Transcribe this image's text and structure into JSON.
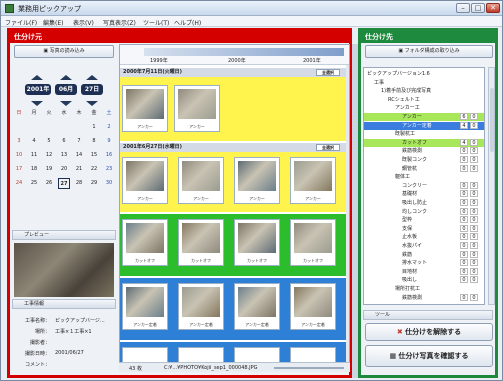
{
  "window": {
    "title": "業務用ピックアップ"
  },
  "menu": [
    "ファイル(F)",
    "編集(E)",
    "表示(V)",
    "写真表示(Z)",
    "ツール(T)",
    "ヘルプ(H)"
  ],
  "left": {
    "header": "仕分け元",
    "load_button": "写真の読み込み",
    "year": "2001年",
    "month": "06月",
    "day": "27日",
    "weekdays": [
      "日",
      "月",
      "火",
      "水",
      "木",
      "金",
      "土"
    ],
    "cal_rows": [
      [
        "",
        "",
        "",
        "",
        "",
        "1",
        "2"
      ],
      [
        "3",
        "4",
        "5",
        "6",
        "7",
        "8",
        "9"
      ],
      [
        "10",
        "11",
        "12",
        "13",
        "14",
        "15",
        "16"
      ],
      [
        "17",
        "18",
        "19",
        "20",
        "21",
        "22",
        "23"
      ],
      [
        "24",
        "25",
        "26",
        "27",
        "28",
        "29",
        "30"
      ]
    ],
    "preview_label": "プレビュー",
    "info_label": "工事情報",
    "info": [
      {
        "k": "工事名称：",
        "v": "ピックアップバージ..."
      },
      {
        "k": "場所：",
        "v": "工事×１工事×1"
      },
      {
        "k": "撮影者：",
        "v": ""
      },
      {
        "k": "撮影日時：",
        "v": "2001/06/27"
      },
      {
        "k": "コメント：",
        "v": ""
      }
    ]
  },
  "timeline": {
    "years": [
      "1999年",
      "2000年",
      "2001年"
    ]
  },
  "groups": [
    {
      "date": "2000年7月11日(火曜日)",
      "select_all": "全選択",
      "captions": [
        "アンカー",
        "アンカー"
      ]
    },
    {
      "date": "2001年6月27日(水曜日)",
      "select_all": "全選択",
      "rows": [
        [
          "アンカー",
          "アンカー",
          "アンカー",
          "アンカー"
        ],
        [
          "カットオフ",
          "カットオフ",
          "カットオフ",
          "カットオフ"
        ],
        [
          "アンカー定着",
          "アンカー定着",
          "アンカー定着",
          "アンカー定着"
        ]
      ]
    }
  ],
  "status": {
    "count": "43 枚",
    "path": "C:¥...¥PHOTO¥Kojii_sep1_000048.JPG"
  },
  "right": {
    "header": "仕分け先",
    "folder_button": "フォルダ構成の取り込み",
    "tree": [
      {
        "label": "ピックアップバージョン1.6",
        "level": 0,
        "a": "",
        "b": ""
      },
      {
        "label": "工事",
        "level": 1,
        "a": "",
        "b": ""
      },
      {
        "label": "1)着手前及び完成写真",
        "level": 2,
        "a": "",
        "b": ""
      },
      {
        "label": "RCシェルト工",
        "level": 3,
        "a": "",
        "b": ""
      },
      {
        "label": "アンカー工",
        "level": 4,
        "a": "",
        "b": ""
      },
      {
        "label": "アンカー",
        "level": 5,
        "a": "6",
        "b": "0"
      },
      {
        "label": "アンカー定着",
        "level": 5,
        "a": "4",
        "b": "0"
      },
      {
        "label": "既製杭工",
        "level": 4,
        "a": "",
        "b": ""
      },
      {
        "label": "カットオフ",
        "level": 5,
        "a": "4",
        "b": "0"
      },
      {
        "label": "鉄筋検測",
        "level": 5,
        "a": "0",
        "b": "0"
      },
      {
        "label": "既製コンク",
        "level": 5,
        "a": "0",
        "b": "0"
      },
      {
        "label": "鋼管杭",
        "level": 5,
        "a": "0",
        "b": "0"
      },
      {
        "label": "躯体工",
        "level": 4,
        "a": "",
        "b": ""
      },
      {
        "label": "コンクリー",
        "level": 5,
        "a": "0",
        "b": "0"
      },
      {
        "label": "基礎材",
        "level": 5,
        "a": "0",
        "b": "0"
      },
      {
        "label": "吸出し防止",
        "level": 5,
        "a": "0",
        "b": "0"
      },
      {
        "label": "均しコンク",
        "level": 5,
        "a": "0",
        "b": "0"
      },
      {
        "label": "型枠",
        "level": 5,
        "a": "0",
        "b": "0"
      },
      {
        "label": "支保",
        "level": 5,
        "a": "0",
        "b": "0"
      },
      {
        "label": "止水板",
        "level": 5,
        "a": "0",
        "b": "0"
      },
      {
        "label": "水抜パイ",
        "level": 5,
        "a": "0",
        "b": "0"
      },
      {
        "label": "鉄筋",
        "level": 5,
        "a": "0",
        "b": "0"
      },
      {
        "label": "排水マット",
        "level": 5,
        "a": "0",
        "b": "0"
      },
      {
        "label": "目地材",
        "level": 5,
        "a": "0",
        "b": "0"
      },
      {
        "label": "吸出し",
        "level": 5,
        "a": "0",
        "b": "0"
      },
      {
        "label": "場所打杭工",
        "level": 4,
        "a": "",
        "b": ""
      },
      {
        "label": "鉄筋検測",
        "level": 5,
        "a": "0",
        "b": "0"
      }
    ],
    "tool_label": "ツール",
    "release_button": "仕分けを解除する",
    "confirm_button": "仕分け写真を確認する"
  }
}
